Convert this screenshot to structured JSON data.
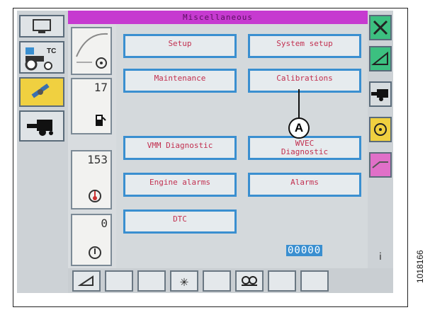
{
  "screen": {
    "title": "Miscellaneous"
  },
  "left_panel": {
    "tiles": [
      {
        "name": "display-settings-tile",
        "icon": "monitor-icon",
        "label": "",
        "selected": false
      },
      {
        "name": "tractor-tc-tile",
        "icon": "tractor-icon",
        "label": "TC",
        "selected": false
      },
      {
        "name": "satellite-tile",
        "icon": "satellite-icon",
        "label": "",
        "selected": true
      },
      {
        "name": "combine-tile",
        "icon": "combine-icon",
        "label": "",
        "selected": false
      }
    ]
  },
  "gauges": [
    {
      "name": "engine-load-gauge",
      "value": "",
      "icon": "engine-icon"
    },
    {
      "name": "fuel-gauge",
      "value": "17",
      "icon": "fuel-pump-icon"
    },
    {
      "name": "coolant-temp-gauge",
      "value": "153",
      "icon": "thermometer-icon"
    },
    {
      "name": "oil-gauge",
      "value": "0",
      "icon": "oil-icon"
    }
  ],
  "buttons": {
    "setup": "Setup",
    "system_setup": "System setup",
    "maintenance": "Maintenance",
    "calibrations": "Calibrations",
    "vmm_diagnostic": "VMM Diagnostic",
    "wvec_line1": "WVEC",
    "wvec_line2": "Diagnostic",
    "engine_alarms": "Engine alarms",
    "alarms": "Alarms",
    "dtc": "DTC"
  },
  "counter": "00000",
  "right_panel": {
    "tiles": [
      "tools-icon",
      "header-tilt-icon",
      "combine-icon",
      "engine-icon",
      "header-icon",
      "info-icon"
    ]
  },
  "bottom_bar": {
    "slots": [
      "header-float-icon",
      "",
      "",
      "snowflake-icon",
      "",
      "link-icon",
      "",
      ""
    ]
  },
  "callout": {
    "label": "A"
  },
  "document_number": "1018166"
}
